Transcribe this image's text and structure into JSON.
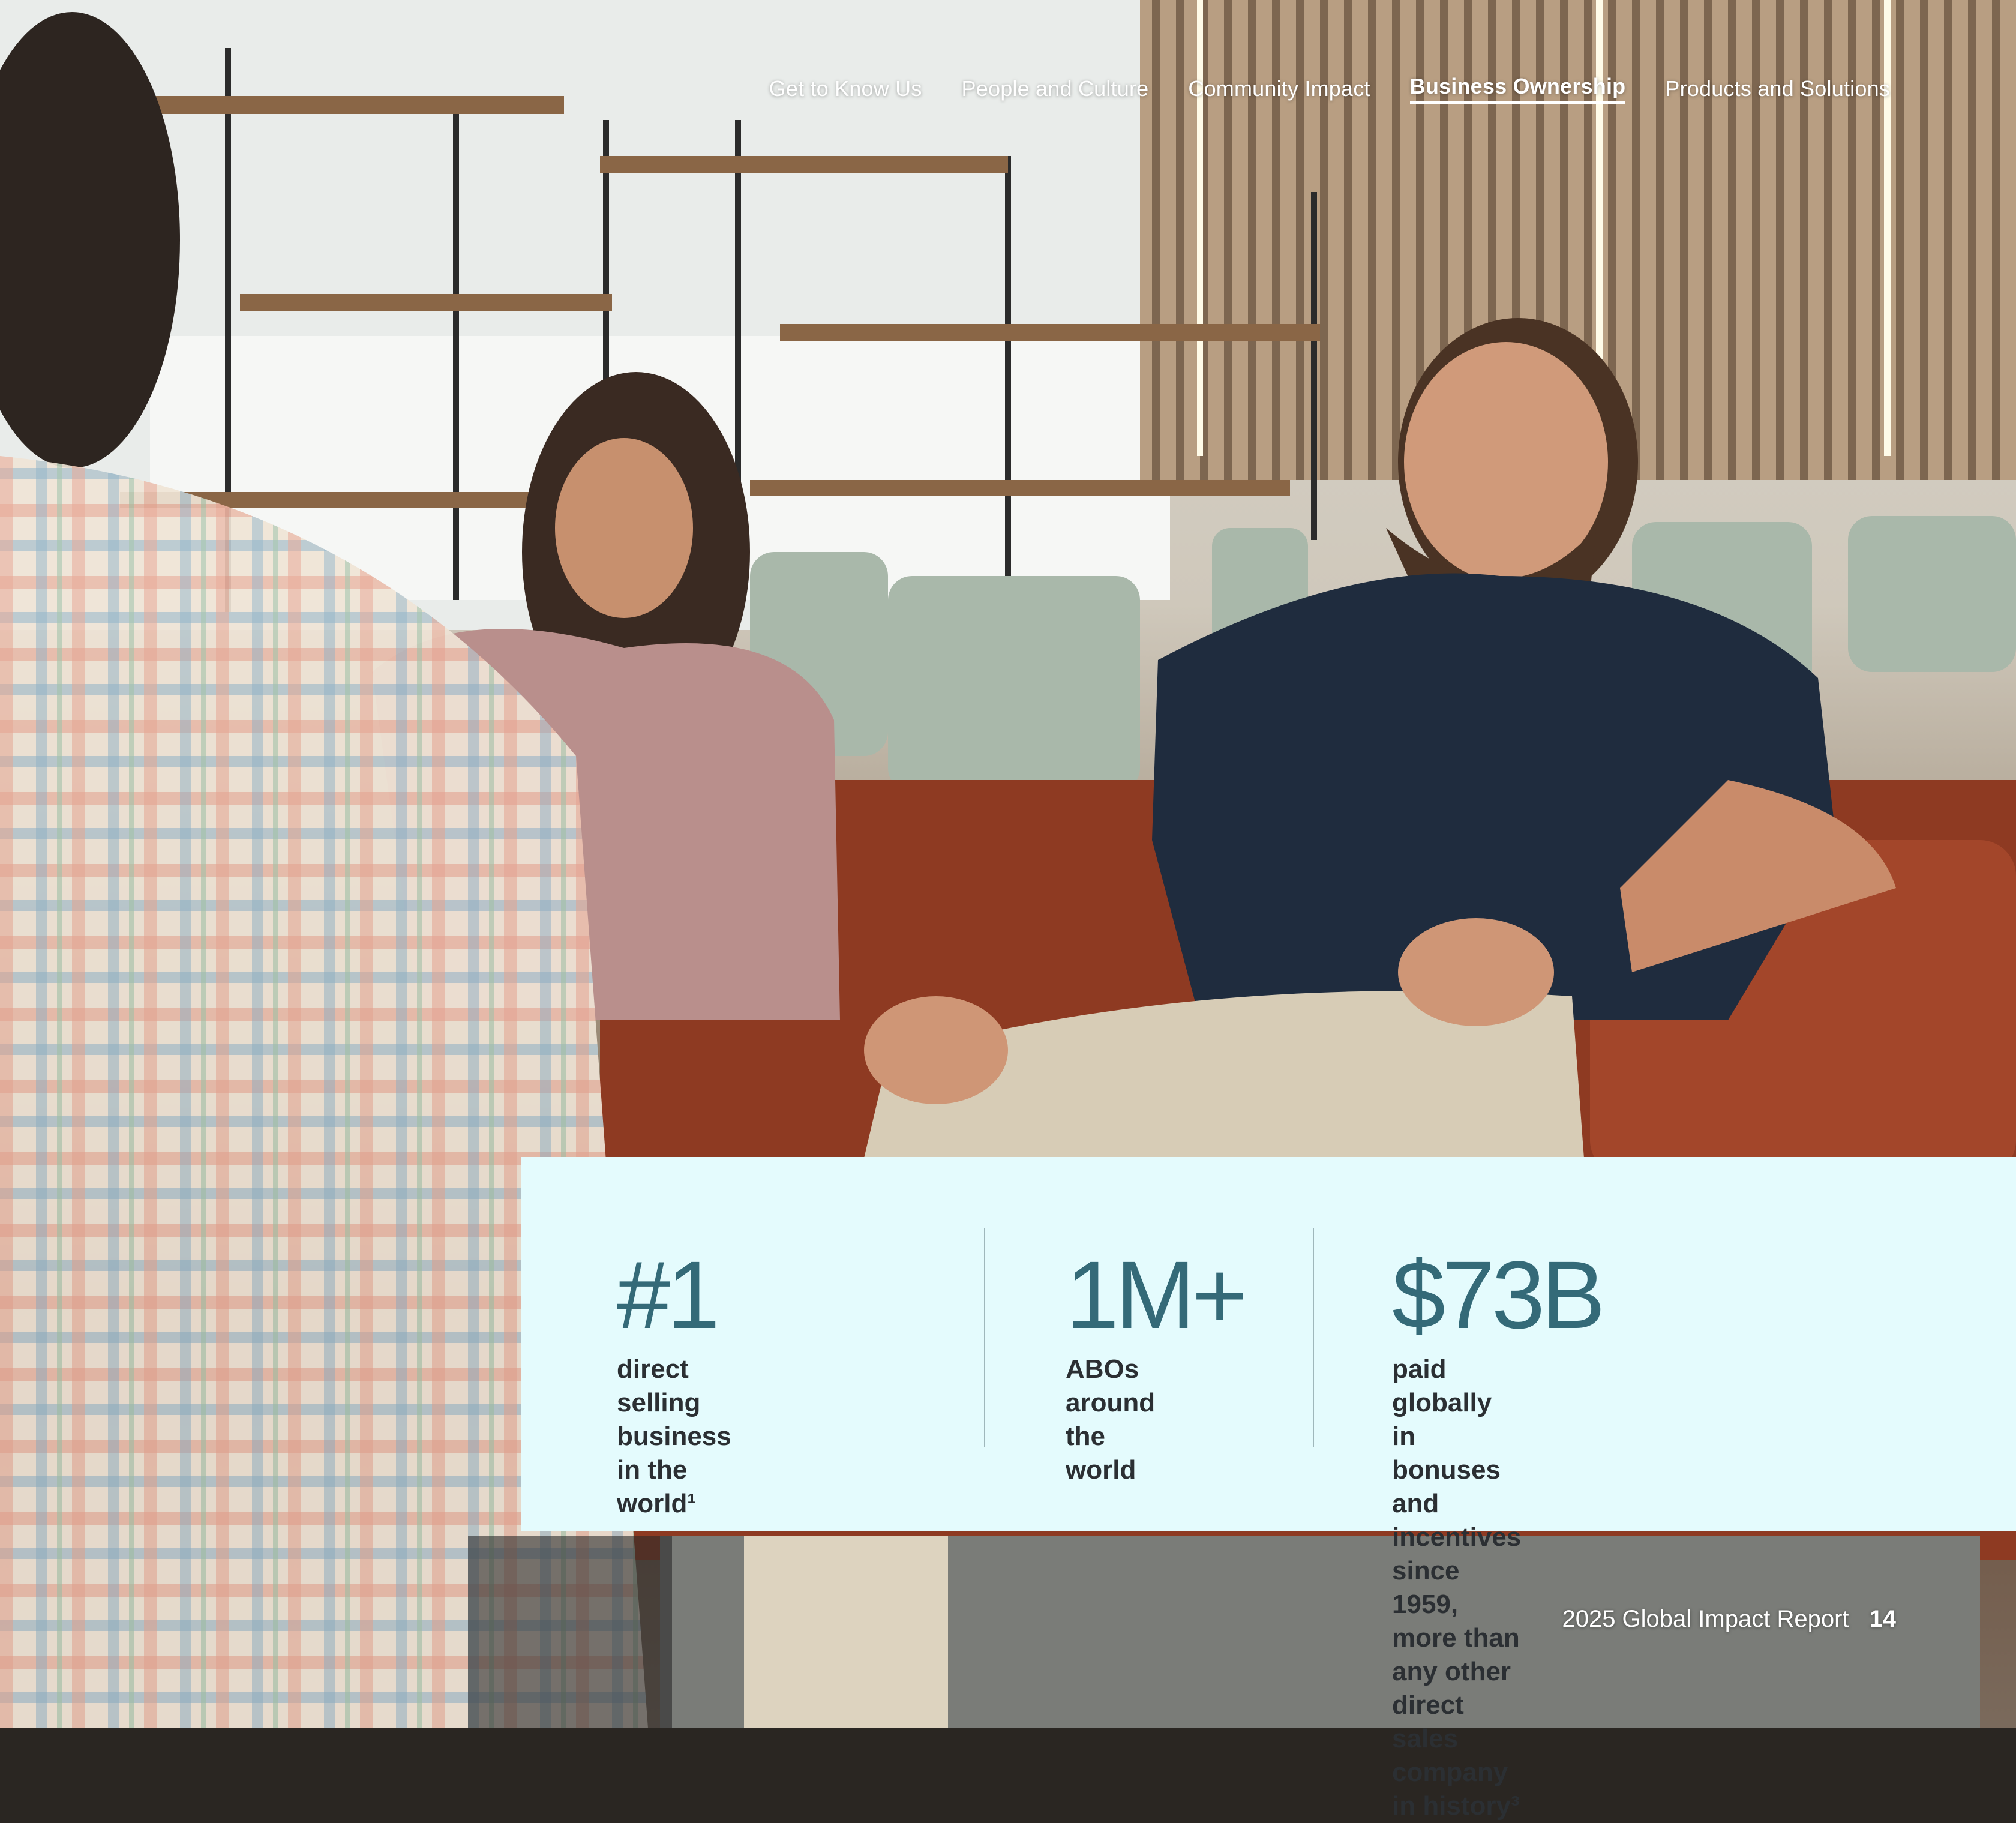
{
  "nav": {
    "items": [
      {
        "label": "Get to Know Us",
        "active": false
      },
      {
        "label": "People and Culture",
        "active": false
      },
      {
        "label": "Community Impact",
        "active": false
      },
      {
        "label": "Business Ownership",
        "active": true
      },
      {
        "label": "Products and Solutions",
        "active": false
      }
    ]
  },
  "stats": [
    {
      "value": "#1",
      "line1": "direct selling business",
      "line2": "in the world¹",
      "line3": ""
    },
    {
      "value": "1M+",
      "line1": "ABOs around",
      "line2": "the world",
      "line3": ""
    },
    {
      "value": "$73B",
      "line1": "paid globally in bonuses and incentives",
      "line2": "since 1959, more than any other direct",
      "line3": "sales company in history³"
    }
  ],
  "footer": {
    "report_title": "2025 Global Impact Report",
    "page_number": "14"
  },
  "colors": {
    "stat_value": "#346a78",
    "stats_panel": "#e4fbfd",
    "stat_text": "#2b2f33"
  }
}
